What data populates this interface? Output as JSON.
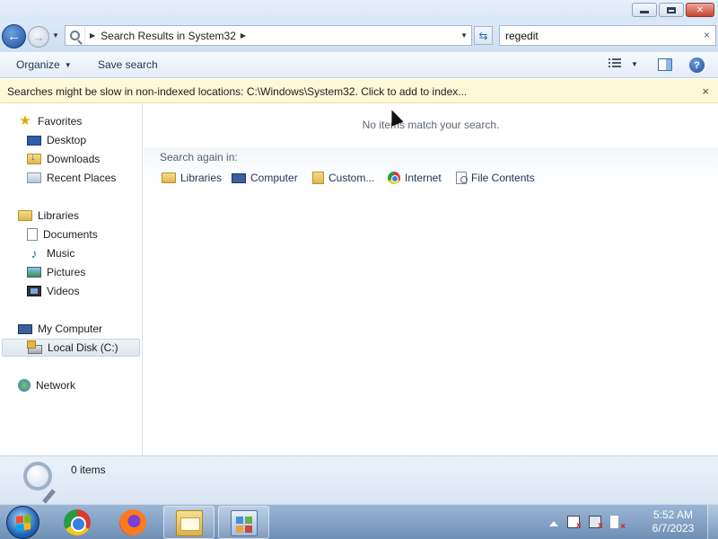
{
  "window": {
    "caption_buttons": {
      "minimize": "minimize",
      "maximize": "maximize",
      "close": "close"
    }
  },
  "navigation": {
    "breadcrumb": [
      "Search Results in System32"
    ],
    "search_value": "regedit",
    "search_clear": "×"
  },
  "toolbar": {
    "organize_label": "Organize",
    "save_search_label": "Save search"
  },
  "infobar": {
    "message": "Searches might be slow in non-indexed locations: C:\\Windows\\System32. Click to add to index...",
    "close": "×"
  },
  "sidebar": {
    "favorites": {
      "label": "Favorites",
      "items": [
        "Desktop",
        "Downloads",
        "Recent Places"
      ]
    },
    "libraries": {
      "label": "Libraries",
      "items": [
        "Documents",
        "Music",
        "Pictures",
        "Videos"
      ]
    },
    "computer": {
      "label": "My Computer",
      "items": [
        "Local Disk (C:)"
      ]
    },
    "network": {
      "label": "Network"
    }
  },
  "content": {
    "empty_message": "No items match your search.",
    "search_again_label": "Search again in:",
    "search_again_items": [
      "Libraries",
      "Computer",
      "Custom...",
      "Internet",
      "File Contents"
    ]
  },
  "details": {
    "count": "0 items"
  },
  "taskbar": {
    "pinned": [
      "chrome-icon",
      "firefox-icon",
      "explorer-icon",
      "control-panel-icon"
    ],
    "clock_time": "5:52 AM",
    "clock_date": "6/7/2023"
  }
}
